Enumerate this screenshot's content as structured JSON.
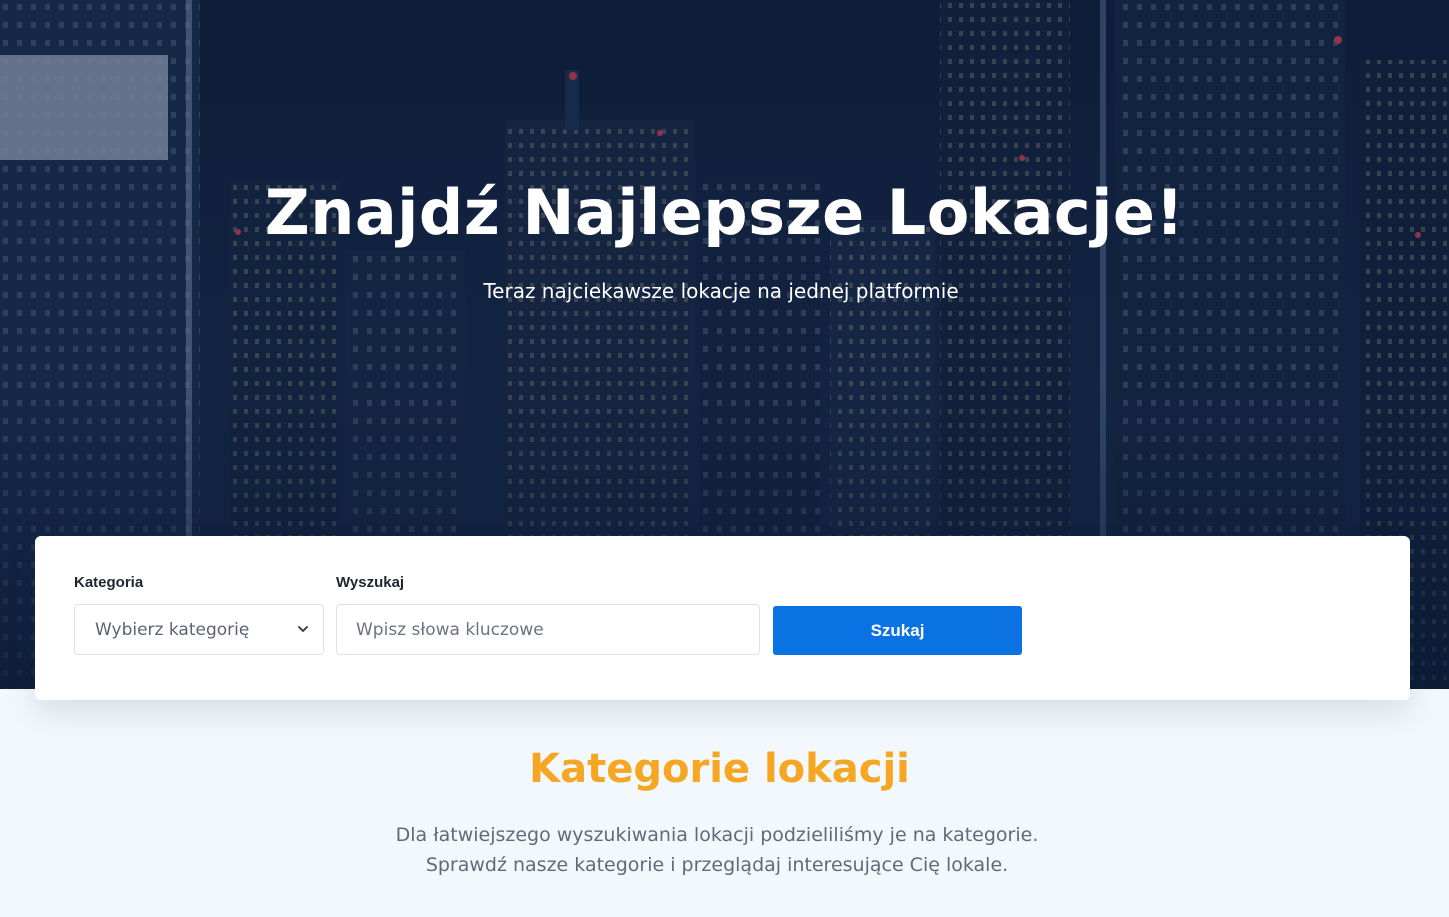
{
  "hero": {
    "title": "Znajdź Najlepsze Lokacje!",
    "subtitle": "Teraz najciekawsze lokacje na jednej platformie"
  },
  "search": {
    "category_label": "Kategoria",
    "category_value": "Wybierz kategorię",
    "keyword_label": "Wyszukaj",
    "keyword_placeholder": "Wpisz słowa kluczowe",
    "button_label": "Szukaj"
  },
  "categories_section": {
    "title": "Kategorie lokacji",
    "description_line1": "Dla łatwiejszego wyszukiwania lokacji podzieliliśmy je na kategorie.",
    "description_line2": "Sprawdź nasze kategorie i przeglądaj interesujące Cię lokale."
  },
  "colors": {
    "accent_orange": "#f5a623",
    "button_blue": "#0b72e3",
    "hero_dark": "#15294a"
  },
  "icons": {
    "select_chevron": "chevron-down-icon"
  }
}
